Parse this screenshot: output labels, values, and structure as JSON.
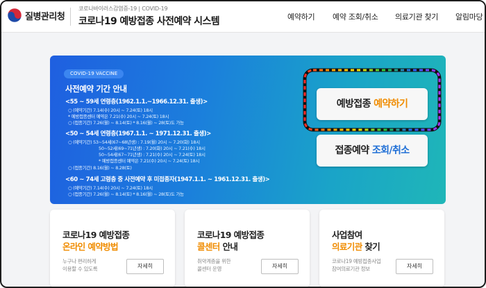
{
  "header": {
    "org_name": "질병관리청",
    "subtitle": "코로나바이러스감염증-19 | COVID-19",
    "title": "코로나19 예방접종 사전예약 시스템",
    "nav": [
      "예약하기",
      "예약 조회/취소",
      "의료기관 찾기",
      "알림마당"
    ]
  },
  "hero": {
    "badge": "COVID-19 VACCINE",
    "title": "사전예약 기간 안내",
    "groups": [
      {
        "title": "<55 ~ 59세 연령층(1962.1.1.~1966.12.31. 출생)>",
        "lines": [
          "○ (예약기간) 7.14(수) 20시 ~ 7.24(토) 18시",
          "* 예방접종센터 예약은 7.21(수) 20시 ~ 7.24(토) 18시",
          "○ (접종기간) 7.26(월) ~ 8.14(토)      * 8.16(월) ~ 28(토)도 가능"
        ]
      },
      {
        "title": "<50 ~ 54세 연령층(1967.1.1. ~ 1971.12.31. 출생)>",
        "lines": [
          "○ (예약기간) 53~54세(67~68년생) : 7.19(월) 20시 ~ 7.20(화) 18시",
          "50~52세(69~71년생) : 7.20(화) 20시 ~ 7.21(수) 18시",
          "50~54세(67~71년생) : 7.21(수) 20시 ~ 7.24(토) 18시",
          "* 예방접종센터 예약은 7.21(수) 20시 ~ 7.24(토) 18시",
          "○ (접종기간) 8.16(월) ~ 8.28(토)"
        ]
      },
      {
        "title": "<60 ~ 74세 고령층 중 사전예약 후 미접종자(1947.1.1. ~ 1961.12.31. 출생)>",
        "lines": [
          "○ (예약기간) 7.14(수) 20시 ~ 7.24(토) 18시",
          "○ (접종기간) 7.26(월) ~ 8.14(토)      * 8.16(월) ~ 28(토)도 가능"
        ]
      }
    ],
    "reserve_button": {
      "prefix": "예방접종 ",
      "highlight": "예약하기"
    },
    "inquiry_button": {
      "prefix": "접종예약 ",
      "highlight": "조회/취소"
    }
  },
  "cards": [
    {
      "line1": "코로나19 예방접종",
      "line2_em": "온라인 예약방법",
      "line2_rest": "",
      "desc1": "누구나 편리하게",
      "desc2": "이용할 수 있도록",
      "more": "자세히"
    },
    {
      "line1": "코로나19 예방접종",
      "line2_em": "콜센터",
      "line2_rest": " 안내",
      "desc1": "취약계층을 위한",
      "desc2": "콜센터 운영",
      "more": "자세히"
    },
    {
      "line1": "사업참여",
      "line2_em": "의료기관",
      "line2_rest": " 찾기",
      "desc1": "코로나19 예방접종사업",
      "desc2": "참여의료기관 정보",
      "more": "자세히"
    }
  ],
  "colors": {
    "accent_orange": "#f08c00",
    "accent_blue": "#1f6fd6",
    "hero_start": "#1f5fe0",
    "hero_end": "#1fb6b8"
  }
}
